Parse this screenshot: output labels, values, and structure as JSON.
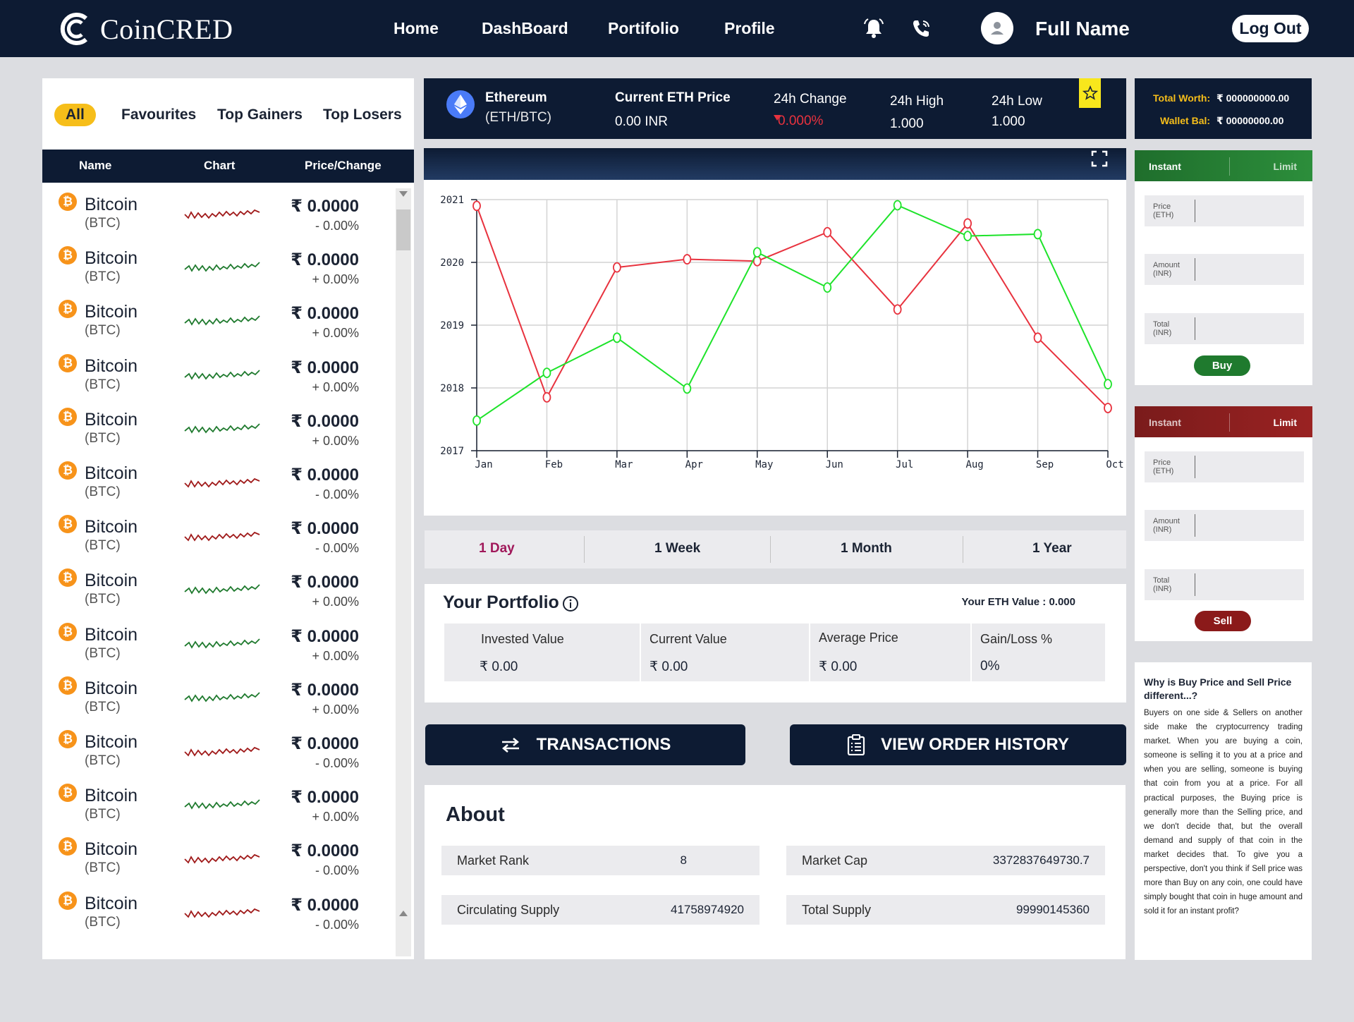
{
  "brand": {
    "name": "CoinCRED"
  },
  "nav": {
    "items": [
      "Home",
      "DashBoard",
      "Portifolio",
      "Profile"
    ],
    "user_name": "Full Name",
    "logout_label": "Log Out"
  },
  "filters": [
    "All",
    "Favourites",
    "Top Gainers",
    "Top Losers"
  ],
  "list_headers": {
    "name": "Name",
    "chart": "Chart",
    "price": "Price/Change"
  },
  "coins": [
    {
      "name": "Bitcoin",
      "symbol": "(BTC)",
      "price": "₹ 0.0000",
      "change": "- 0.00%",
      "trend": "down"
    },
    {
      "name": "Bitcoin",
      "symbol": "(BTC)",
      "price": "₹ 0.0000",
      "change": "+ 0.00%",
      "trend": "up"
    },
    {
      "name": "Bitcoin",
      "symbol": "(BTC)",
      "price": "₹ 0.0000",
      "change": "+ 0.00%",
      "trend": "up"
    },
    {
      "name": "Bitcoin",
      "symbol": "(BTC)",
      "price": "₹ 0.0000",
      "change": "+ 0.00%",
      "trend": "up"
    },
    {
      "name": "Bitcoin",
      "symbol": "(BTC)",
      "price": "₹ 0.0000",
      "change": "+ 0.00%",
      "trend": "up"
    },
    {
      "name": "Bitcoin",
      "symbol": "(BTC)",
      "price": "₹ 0.0000",
      "change": "- 0.00%",
      "trend": "down"
    },
    {
      "name": "Bitcoin",
      "symbol": "(BTC)",
      "price": "₹ 0.0000",
      "change": "- 0.00%",
      "trend": "down"
    },
    {
      "name": "Bitcoin",
      "symbol": "(BTC)",
      "price": "₹ 0.0000",
      "change": "+ 0.00%",
      "trend": "up"
    },
    {
      "name": "Bitcoin",
      "symbol": "(BTC)",
      "price": "₹ 0.0000",
      "change": "+ 0.00%",
      "trend": "up"
    },
    {
      "name": "Bitcoin",
      "symbol": "(BTC)",
      "price": "₹ 0.0000",
      "change": "+ 0.00%",
      "trend": "up"
    },
    {
      "name": "Bitcoin",
      "symbol": "(BTC)",
      "price": "₹ 0.0000",
      "change": "- 0.00%",
      "trend": "down"
    },
    {
      "name": "Bitcoin",
      "symbol": "(BTC)",
      "price": "₹ 0.0000",
      "change": "+ 0.00%",
      "trend": "up"
    },
    {
      "name": "Bitcoin",
      "symbol": "(BTC)",
      "price": "₹ 0.0000",
      "change": "- 0.00%",
      "trend": "down"
    },
    {
      "name": "Bitcoin",
      "symbol": "(BTC)",
      "price": "₹ 0.0000",
      "change": "- 0.00%",
      "trend": "down"
    }
  ],
  "eth": {
    "name": "Ethereum",
    "pair": "(ETH/BTC)",
    "price_label": "Current ETH Price",
    "price_value": "0.00 INR",
    "change_label": "24h Change",
    "change_value": "0.000%",
    "high_label": "24h High",
    "high_value": "1.000",
    "low_label": "24h Low",
    "low_value": "1.000"
  },
  "chart_data": {
    "type": "line",
    "categories": [
      "Jan",
      "Feb",
      "Mar",
      "Apr",
      "May",
      "Jun",
      "Jul",
      "Aug",
      "Sep",
      "Oct"
    ],
    "y_ticks": [
      "2017",
      "2018",
      "2019",
      "2020",
      "2021"
    ],
    "ylim": [
      2017,
      2021
    ],
    "grid": true,
    "series": [
      {
        "color": "#e8323e",
        "values": [
          2020.9,
          2017.85,
          2019.92,
          2020.05,
          2020.02,
          2020.48,
          2019.25,
          2020.62,
          2018.8,
          2017.68
        ]
      },
      {
        "color": "#1ee32a",
        "values": [
          2017.48,
          2018.24,
          2018.8,
          2017.99,
          2020.16,
          2019.6,
          2020.91,
          2020.42,
          2020.45,
          2018.06
        ]
      }
    ]
  },
  "ranges": [
    "1 Day",
    "1 Week",
    "1 Month",
    "1 Year"
  ],
  "portfolio": {
    "title": "Your Portfolio",
    "eth_value": "Your ETH Value : 0.000",
    "columns": [
      {
        "label": "Invested Value",
        "value": "₹ 0.00"
      },
      {
        "label": "Current Value",
        "value": "₹ 0.00"
      },
      {
        "label": "Average Price",
        "value": "₹ 0.00"
      },
      {
        "label": "Gain/Loss %",
        "value": "0%"
      }
    ]
  },
  "actions": {
    "transactions": "TRANSACTIONS",
    "order_history": "VIEW ORDER HISTORY"
  },
  "about": {
    "title": "About",
    "rows": [
      {
        "label": "Market Rank",
        "value": "8"
      },
      {
        "label": "Market Cap",
        "value": "3372837649730.7"
      },
      {
        "label": "Circulating Supply",
        "value": "41758974920"
      },
      {
        "label": "Total Supply",
        "value": "99990145360"
      }
    ]
  },
  "wallet": {
    "worth_label": "Total Worth:",
    "worth_value": "₹ 000000000.00",
    "bal_label": "Wallet Bal:",
    "bal_value": "₹ 00000000.00"
  },
  "buy_box": {
    "tab_instant": "Instant",
    "tab_limit": "Limit",
    "accent": "#1f7a2e",
    "fields": [
      {
        "l1": "Price",
        "l2": "(ETH)"
      },
      {
        "l1": "Amount",
        "l2": "(INR)"
      },
      {
        "l1": "Total",
        "l2": "(INR)"
      }
    ],
    "button": "Buy"
  },
  "sell_box": {
    "tab_instant": "Instant",
    "tab_limit": "Limit",
    "accent": "#8b1a1a",
    "fields": [
      {
        "l1": "Price",
        "l2": "(ETH)"
      },
      {
        "l1": "Amount",
        "l2": "(INR)"
      },
      {
        "l1": "Total",
        "l2": "(INR)"
      }
    ],
    "button": "Sell"
  },
  "faq": {
    "question": "Why is Buy Price and Sell Price different...?",
    "answer": "Buyers on one side & Sellers on another side make the cryptocurrency trading market. When you are buying a coin, someone is selling it to you at a price and when you are selling, someone is buying that coin from you at a price. For all practical purposes, the Buying price is generally more than the Selling price, and we don't decide that, but the overall demand and supply of that coin in the market decides that. To give you a perspective, don't you think if Sell price was more than Buy on any coin, one could have simply bought that coin in huge amount and sold it for an instant profit?"
  }
}
